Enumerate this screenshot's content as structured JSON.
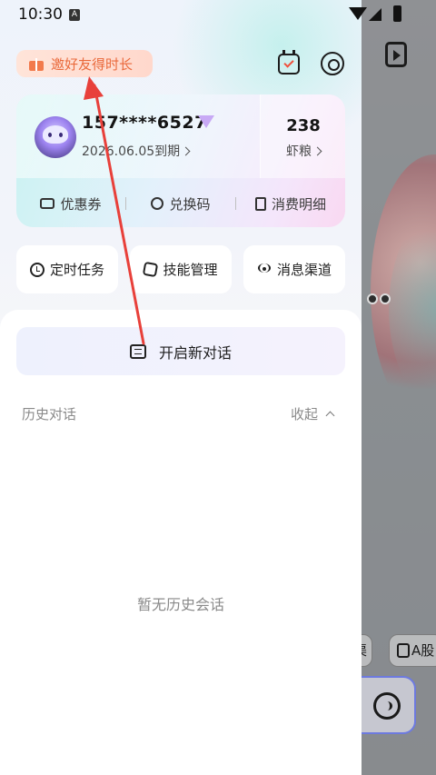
{
  "status_bar": {
    "time": "10:30",
    "notification_letter": "A"
  },
  "header": {
    "invite_label": "邀好友得时长",
    "calendar_icon": "calendar-check-icon",
    "settings_icon": "settings-ring-icon"
  },
  "account": {
    "phone": "157****6527",
    "expire_text": "2026.06.05到期",
    "points_value": "238",
    "points_label": "虾粮",
    "links": [
      {
        "label": "优惠券",
        "icon": "ticket-icon"
      },
      {
        "label": "兑换码",
        "icon": "key-icon"
      },
      {
        "label": "消费明细",
        "icon": "receipt-icon"
      }
    ]
  },
  "features": [
    {
      "label": "定时任务",
      "icon": "alarm-clock-icon"
    },
    {
      "label": "技能管理",
      "icon": "puzzle-icon"
    },
    {
      "label": "消息渠道",
      "icon": "broadcast-icon"
    }
  ],
  "new_chat_label": "开启新对话",
  "history": {
    "title": "历史对话",
    "collapse_label": "收起",
    "empty_text": "暂无历史会话"
  },
  "background_app": {
    "chip1_text": "渠",
    "chip2_text": "A股"
  },
  "colors": {
    "accent_orange": "#ea6a3c",
    "annotation_red": "#e8403a",
    "input_border": "#6d7adf"
  }
}
